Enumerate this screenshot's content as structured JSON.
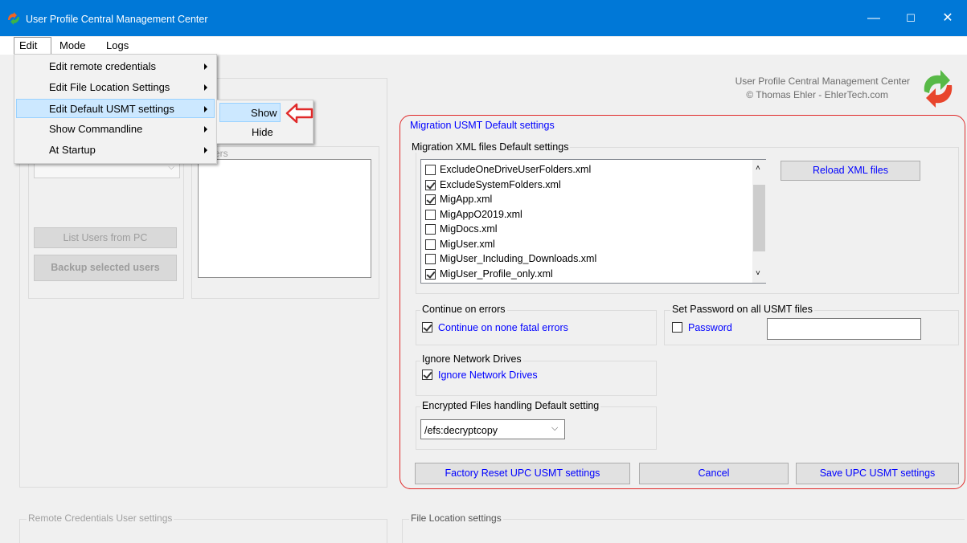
{
  "window": {
    "title": "User Profile Central Management Center",
    "controls": {
      "minimize": "—",
      "maximize": "☐",
      "close": "✕"
    }
  },
  "menubar": {
    "items": [
      "Edit",
      "Mode",
      "Logs"
    ]
  },
  "edit_menu": {
    "items": [
      "Edit remote credentials",
      "Edit File Location Settings",
      "Edit Default USMT settings",
      "Show Commandline",
      "At Startup"
    ]
  },
  "submenu": {
    "items": [
      "Show",
      "Hide"
    ]
  },
  "background": {
    "users_title_fragment": "ers",
    "list_users_button": "List Users from PC",
    "backup_button": "Backup selected users",
    "remote_credentials_title": "Remote Credentials User settings",
    "file_location_title": "File Location settings"
  },
  "branding": {
    "line1": "User Profile Central Management Center",
    "line2": "© Thomas Ehler - EhlerTech.com"
  },
  "usmt": {
    "title": "Migration USMT Default settings",
    "xml_group_title": "Migration XML files Default settings",
    "xml_files": [
      {
        "name": "ExcludeOneDriveUserFolders.xml",
        "checked": false
      },
      {
        "name": "ExcludeSystemFolders.xml",
        "checked": true
      },
      {
        "name": "MigApp.xml",
        "checked": true
      },
      {
        "name": "MigAppO2019.xml",
        "checked": false
      },
      {
        "name": "MigDocs.xml",
        "checked": false
      },
      {
        "name": "MigUser.xml",
        "checked": false
      },
      {
        "name": "MigUser_Including_Downloads.xml",
        "checked": false
      },
      {
        "name": "MigUser_Profile_only.xml",
        "checked": true
      }
    ],
    "reload_button": "Reload XML files",
    "continue_group_title": "Continue on errors",
    "continue_checkbox_label": "Continue on none fatal errors",
    "continue_checked": true,
    "password_group_title": "Set Password on all USMT files",
    "password_checkbox_label": "Password",
    "password_checked": false,
    "password_value": "",
    "ignore_group_title": "Ignore Network Drives",
    "ignore_checkbox_label": "Ignore Network Drives",
    "ignore_checked": true,
    "efs_group_title": "Encrypted Files handling Default setting",
    "efs_selected": "/efs:decryptcopy",
    "factory_reset_button": "Factory Reset UPC USMT settings",
    "cancel_button": "Cancel",
    "save_button": "Save UPC USMT settings"
  },
  "colors": {
    "titlebar": "#0078d7",
    "highlight": "#cce8ff",
    "blue_text": "#0000ff",
    "red_outline": "#e02a2a"
  }
}
